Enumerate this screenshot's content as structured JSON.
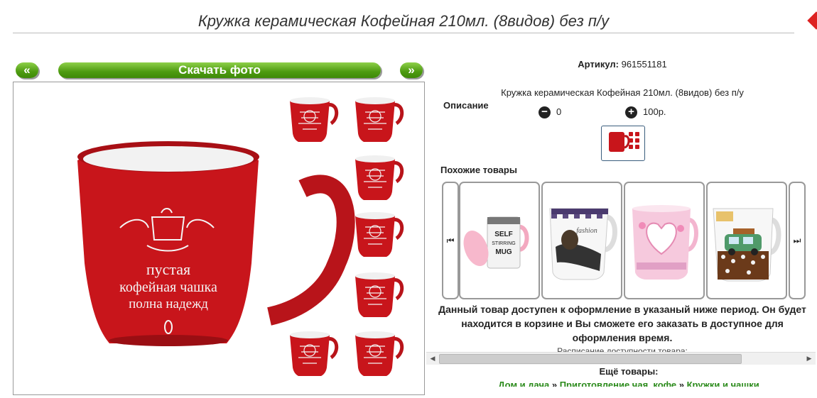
{
  "product": {
    "title": "Кружка керамическая Кофейная 210мл. (8видов) без п/у",
    "sku_label": "Артикул:",
    "sku_value": "961551181",
    "description_text": "Кружка керамическая Кофейная 210мл. (8видов) без п/у",
    "description_label": "Описание",
    "qty_value": "0",
    "price": "100р."
  },
  "gallery": {
    "prev_label": "«",
    "download_label": "Скачать фото",
    "next_label": "»",
    "main_mug_text": [
      "пустая",
      "кофейная чашка",
      "полна надежд"
    ]
  },
  "similar": {
    "title": "Похожие товары",
    "cards": [
      {
        "name": "self-stirring-mug",
        "text": [
          "SELF",
          "STIRRING",
          "MUG"
        ]
      },
      {
        "name": "fashion-mug",
        "text": [
          "fashion"
        ]
      },
      {
        "name": "heart-mug",
        "text": []
      },
      {
        "name": "car-mug",
        "text": []
      }
    ]
  },
  "availability": {
    "notice": "Данный товар доступен к оформление в указаный ниже период. Он будет находится в корзине и Вы сможете его заказать в доступное для оформления время.",
    "schedule_label": "Расписание доступности товара:"
  },
  "more": {
    "title": "Ещё товары:",
    "crumb1": "Дом и дача",
    "sep": " » ",
    "crumb2": "Приготовление чая, кофе",
    "crumb3": "Кружки и чашки"
  },
  "colors": {
    "mug_red": "#c8151b",
    "accent_green": "#4d9a10",
    "link_green": "#2a8a1a"
  }
}
